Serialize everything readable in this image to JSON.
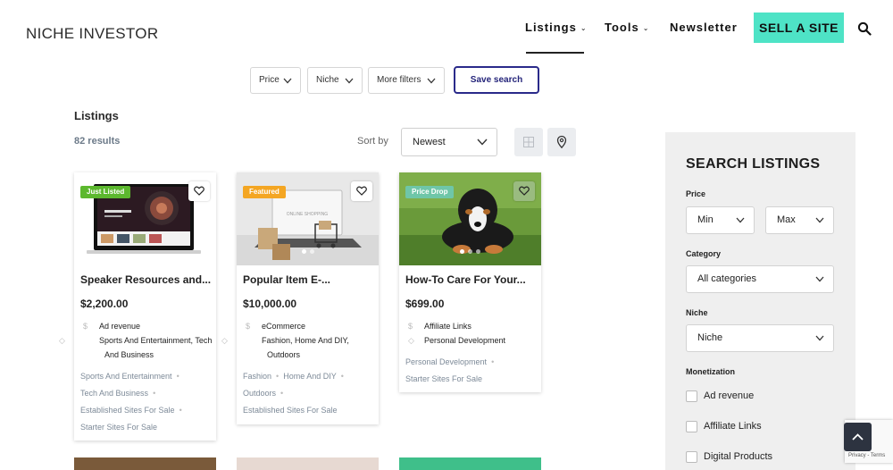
{
  "header": {
    "logo": "NICHE INVESTOR",
    "nav": [
      {
        "label": "Listings",
        "has_dropdown": true,
        "active": true
      },
      {
        "label": "Tools",
        "has_dropdown": true
      },
      {
        "label": "Newsletter",
        "has_dropdown": false
      }
    ],
    "sell_button": "SELL A SITE",
    "search_icon": "search-icon"
  },
  "filters": {
    "items": [
      "Price",
      "Niche",
      "More filters"
    ],
    "save_search": "Save search"
  },
  "listings": {
    "title": "Listings",
    "results": "82 results",
    "sort_label": "Sort by",
    "sort_value": "Newest"
  },
  "cards": [
    {
      "badge": "Just Listed",
      "badge_color": "#5cb82e",
      "title": "Speaker Resources and...",
      "price": "$2,200.00",
      "monetization": "Ad revenue",
      "niche": "Sports And Entertainment, Tech And Business",
      "tags": [
        "Sports And Entertainment",
        "Tech And Business",
        "Established Sites For Sale",
        "Starter Sites For Sale"
      ]
    },
    {
      "badge": "Featured",
      "badge_color": "#f4a623",
      "title": "Popular Item E-...",
      "price": "$10,000.00",
      "monetization": "eCommerce",
      "niche": "Fashion, Home And DIY, Outdoors",
      "tags": [
        "Fashion",
        "Home And DIY",
        "Outdoors",
        "Established Sites For Sale"
      ]
    },
    {
      "badge": "Price Drop",
      "badge_color": "#6fc6a8",
      "title": "How-To Care For Your...",
      "price": "$699.00",
      "monetization": "Affiliate Links",
      "niche": "Personal Development",
      "tags": [
        "Personal Development",
        "Starter Sites For Sale"
      ]
    }
  ],
  "sidebar": {
    "title": "SEARCH LISTINGS",
    "price_label": "Price",
    "price_min": "Min",
    "price_max": "Max",
    "category_label": "Category",
    "category_value": "All categories",
    "niche_label": "Niche",
    "niche_value": "Niche",
    "monetization_label": "Monetization",
    "monetization_options": [
      "Ad revenue",
      "Affiliate Links",
      "Digital Products"
    ]
  },
  "recaptcha": "Privacy - Terms",
  "colors": {
    "accent": "#4ee3c6",
    "save_border": "#2a2a8a",
    "tag_text": "#7d8a98"
  }
}
